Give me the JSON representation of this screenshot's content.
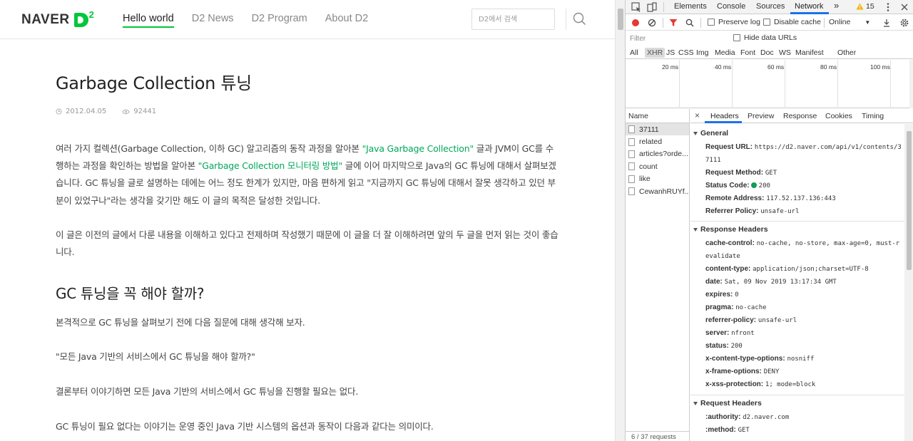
{
  "site": {
    "logo": {
      "naver": "NAVER",
      "d2": "D",
      "sup": "2"
    },
    "nav": [
      {
        "label": "Hello world",
        "active": true
      },
      {
        "label": "D2 News"
      },
      {
        "label": "D2 Program"
      },
      {
        "label": "About D2"
      }
    ],
    "search": {
      "placeholder": "D2에서 검색",
      "icon": "search-icon"
    },
    "article": {
      "title": "Garbage Collection 튜닝",
      "date": "2012.04.05",
      "views": "92441",
      "p1": {
        "t1": "여러 가지 컬렉션(Garbage Collection, 이하 GC) 알고리즘의 동작 과정을 알아본 ",
        "link1": "\"Java Garbage Collection\"",
        "t2": " 글과 JVM이 GC를 수행하는 과정을 확인하는 방법을 알아본 ",
        "link2": "\"Garbage Collection 모니터링 방법\"",
        "t3": " 글에 이어 마지막으로 Java의 GC 튜닝에 대해서 살펴보겠습니다. GC 튜닝을 글로 설명하는 데에는 어느 정도 한계가 있지만, 마음 편하게 읽고 \"지금까지 GC 튜닝에 대해서 잘못 생각하고 있던 부분이 있었구나\"라는 생각을 갖기만 해도 이 글의 목적은 달성한 것입니다."
      },
      "p2": "이 글은 이전의 글에서 다룬 내용을 이해하고 있다고 전제하며 작성했기 때문에 이 글을 더 잘 이해하려면 앞의 두 글을 먼저 읽는 것이 좋습니다.",
      "h2": "GC 튜닝을 꼭 해야 할까?",
      "p3": "본격적으로 GC 튜닝을 살펴보기 전에 다음 질문에 대해 생각해 보자.",
      "p4": "\"모든 Java 기반의 서비스에서 GC 튜닝을 해야 할까?\"",
      "p5": "결론부터 이야기하면 모든 Java 기반의 서비스에서 GC 튜닝을 진행할 필요는 없다.",
      "p6": "GC 튜닝이 필요 없다는 이야기는 운영 중인 Java 기반 시스템의 옵션과 동작이 다음과 같다는 의미이다."
    }
  },
  "devtools": {
    "tabs": [
      "Elements",
      "Console",
      "Sources",
      "Network"
    ],
    "active_tab": "Network",
    "more": "»",
    "warnings": "15",
    "toolbar": {
      "preserve_log": "Preserve log",
      "disable_cache": "Disable cache",
      "throttle": "Online"
    },
    "filter_placeholder": "Filter",
    "hide_data_urls": "Hide data URLs",
    "types": [
      "All",
      "XHR",
      "JS",
      "CSS",
      "Img",
      "Media",
      "Font",
      "Doc",
      "WS",
      "Manifest",
      "Other"
    ],
    "active_type": "XHR",
    "timeline_ticks": [
      "20 ms",
      "40 ms",
      "60 ms",
      "80 ms",
      "100 ms"
    ],
    "name_header": "Name",
    "requests": [
      "37111",
      "related",
      "articles?orde...",
      "count",
      "like",
      "CewanhRUYf..."
    ],
    "footer": "6 / 37 requests",
    "detail_tabs": [
      "Headers",
      "Preview",
      "Response",
      "Cookies",
      "Timing"
    ],
    "active_detail_tab": "Headers",
    "general": {
      "title": "General",
      "request_url_k": "Request URL:",
      "request_url_v1": "https://d2.naver.com/api/v1/contents/3",
      "request_url_v2": "7111",
      "method_k": "Request Method:",
      "method_v": "GET",
      "status_k": "Status Code:",
      "status_v": "200",
      "remote_k": "Remote Address:",
      "remote_v": "117.52.137.136:443",
      "referrer_k": "Referrer Policy:",
      "referrer_v": "unsafe-url"
    },
    "response_headers": {
      "title": "Response Headers",
      "rows": [
        {
          "k": "cache-control:",
          "v": "no-cache, no-store, max-age=0, must-r",
          "v2": "evalidate"
        },
        {
          "k": "content-type:",
          "v": "application/json;charset=UTF-8"
        },
        {
          "k": "date:",
          "v": "Sat, 09 Nov 2019 13:17:34 GMT"
        },
        {
          "k": "expires:",
          "v": "0"
        },
        {
          "k": "pragma:",
          "v": "no-cache"
        },
        {
          "k": "referrer-policy:",
          "v": "unsafe-url"
        },
        {
          "k": "server:",
          "v": "nfront"
        },
        {
          "k": "status:",
          "v": "200"
        },
        {
          "k": "x-content-type-options:",
          "v": "nosniff"
        },
        {
          "k": "x-frame-options:",
          "v": "DENY"
        },
        {
          "k": "x-xss-protection:",
          "v": "1; mode=block"
        }
      ]
    },
    "request_headers": {
      "title": "Request Headers",
      "rows": [
        {
          "k": ":authority:",
          "v": "d2.naver.com"
        },
        {
          "k": ":method:",
          "v": "GET"
        }
      ]
    }
  }
}
